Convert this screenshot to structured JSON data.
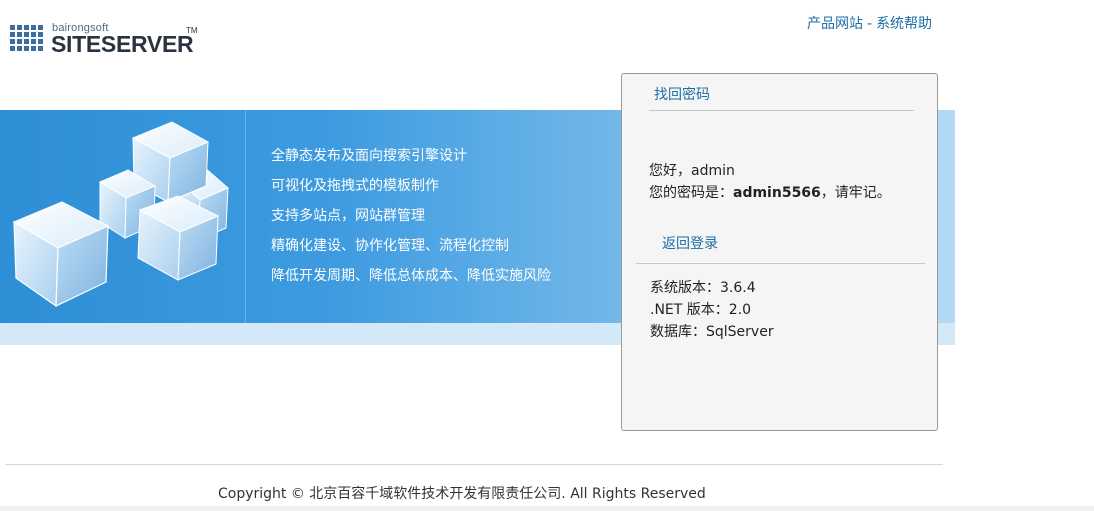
{
  "logo": {
    "small_text": "bairongsoft",
    "big_text": "SITESERVER",
    "tm": "TM"
  },
  "top_links": {
    "product_site": "产品网站",
    "separator": "-",
    "system_help": "系统帮助"
  },
  "banner": {
    "features": [
      "全静态发布及面向搜索引擎设计",
      "可视化及拖拽式的模板制作",
      "支持多站点，网站群管理",
      "精确化建设、协作化管理、流程化控制",
      "降低开发周期、降低总体成本、降低实施风险"
    ]
  },
  "panel": {
    "title": "找回密码",
    "greeting": "您好，admin",
    "password_prefix": "您的密码是：",
    "password_value": "admin5566",
    "password_suffix": "，请牢记。",
    "back_link": "返回登录",
    "info": {
      "version": "系统版本：3.6.4",
      "dotnet": ".NET 版本：2.0",
      "database": "数据库：SqlServer"
    }
  },
  "footer": {
    "copyright": "Copyright © 北京百容千域软件技术开发有限责任公司. All Rights Reserved"
  },
  "colors": {
    "link": "#1c6ea4",
    "banner_start": "#2d8fd6",
    "banner_end": "#b3daf6",
    "panel_bg": "#f5f5f5"
  }
}
